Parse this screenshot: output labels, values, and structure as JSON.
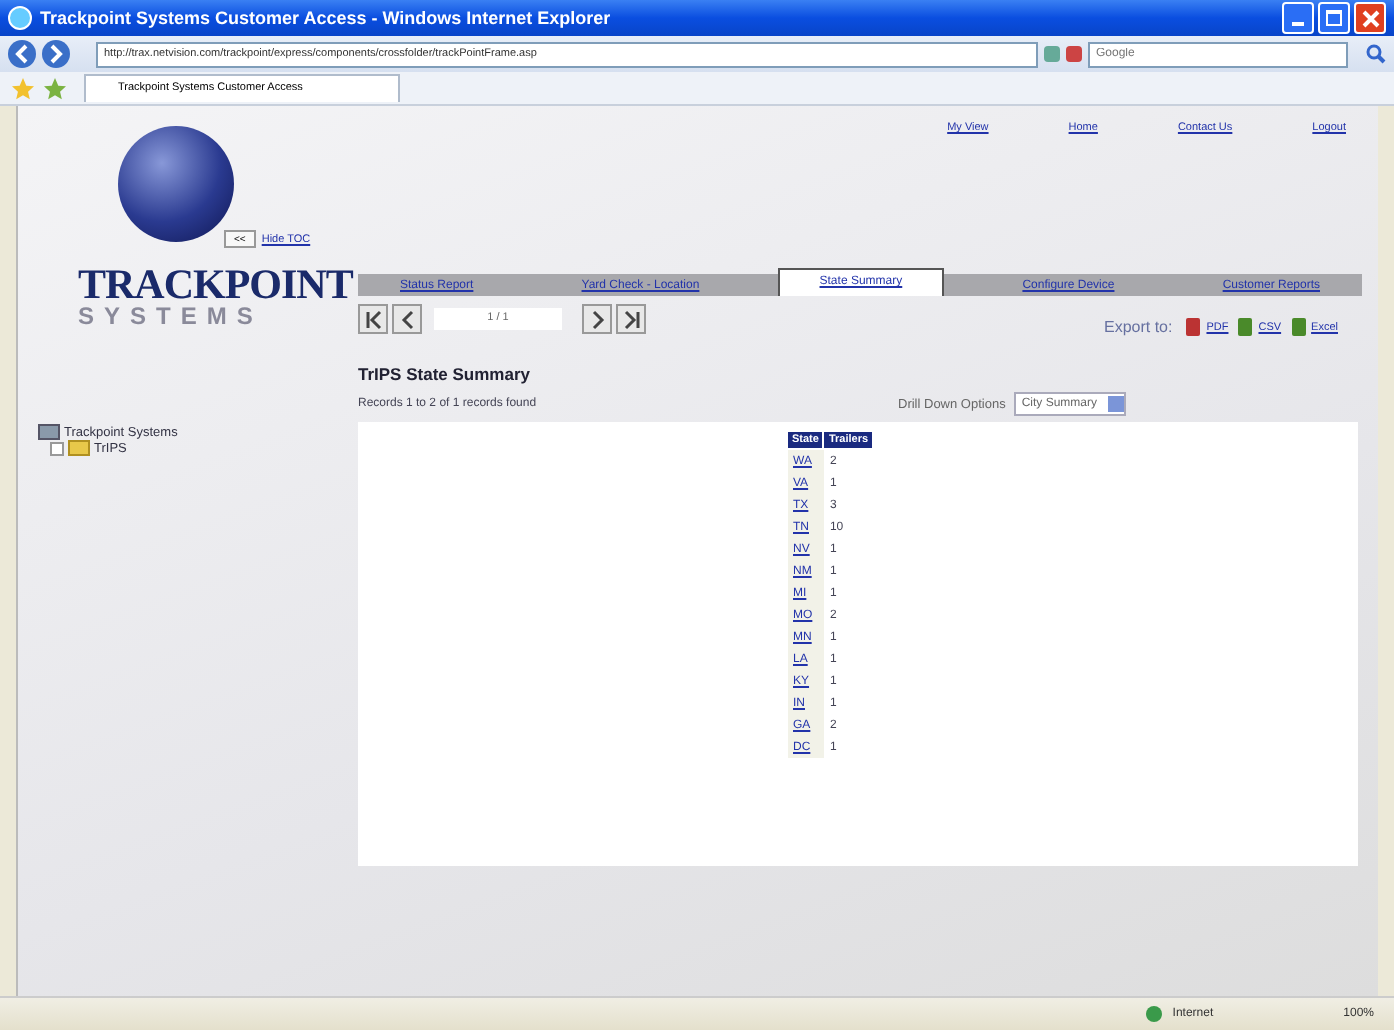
{
  "window": {
    "title": "Trackpoint Systems Customer Access - Windows Internet Explorer"
  },
  "browser": {
    "address": "http://trax.netvision.com/trackpoint/express/components/crossfolder/trackPointFrame.asp",
    "search_placeholder": "Google",
    "tab": "Trackpoint Systems Customer Access"
  },
  "top_links": [
    "My View",
    "Home",
    "Contact Us",
    "Logout"
  ],
  "logo": {
    "name": "TRACKPOINT",
    "tagline": "SYSTEMS"
  },
  "toc": {
    "button": "<<",
    "label": "Hide TOC"
  },
  "tree": [
    {
      "label": "Trackpoint Systems",
      "expanded": true,
      "children": [
        {
          "label": "TrIPS",
          "expanded": false
        }
      ]
    }
  ],
  "tabs": [
    {
      "label": "Status Report",
      "selected": false
    },
    {
      "label": "Yard Check - Location",
      "selected": false
    },
    {
      "label": "State Summary",
      "selected": true
    },
    {
      "label": "Configure Device",
      "selected": false
    },
    {
      "label": "Customer Reports",
      "selected": false
    }
  ],
  "pager": {
    "page": "1 / 1"
  },
  "export": {
    "label": "Export to:",
    "formats": [
      {
        "label": "PDF",
        "kind": "pdf"
      },
      {
        "label": "CSV",
        "kind": "csv"
      },
      {
        "label": "Excel",
        "kind": "excel"
      }
    ]
  },
  "report": {
    "title": "TrIPS State Summary",
    "records": "Records 1 to 2 of 1 records found",
    "drill_label": "Drill Down Options",
    "drill_value": "City Summary"
  },
  "table": {
    "columns": [
      "State",
      "Trailers"
    ],
    "rows": [
      [
        "WA",
        "2"
      ],
      [
        "VA",
        "1"
      ],
      [
        "TX",
        "3"
      ],
      [
        "TN",
        "10"
      ],
      [
        "NV",
        "1"
      ],
      [
        "NM",
        "1"
      ],
      [
        "MI",
        "1"
      ],
      [
        "MO",
        "2"
      ],
      [
        "MN",
        "1"
      ],
      [
        "LA",
        "1"
      ],
      [
        "KY",
        "1"
      ],
      [
        "IN",
        "1"
      ],
      [
        "GA",
        "2"
      ],
      [
        "DC",
        "1"
      ]
    ]
  },
  "status_bar": {
    "zone": "Internet",
    "zoom": "100%"
  }
}
